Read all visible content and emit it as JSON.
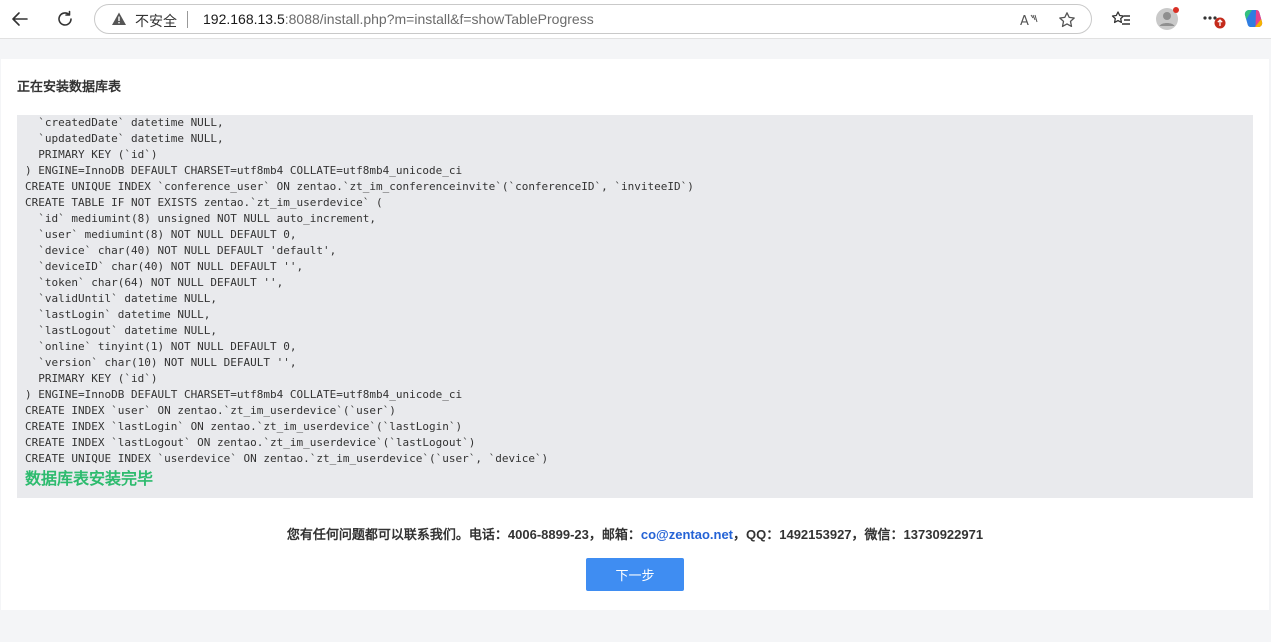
{
  "browser": {
    "insecure_label": "不安全",
    "url_host": "192.168.13.5",
    "url_rest": ":8088/install.php?m=install&f=showTableProgress",
    "icons": {
      "back": "back-arrow-icon",
      "refresh": "refresh-icon",
      "warning": "warning-icon",
      "read_aloud": "read-aloud-icon",
      "favorite": "star-icon",
      "favorites_bar": "favorites-icon",
      "profile": "profile-icon",
      "more": "more-icon",
      "copilot": "copilot-icon"
    },
    "notification_badge": "1"
  },
  "page": {
    "title": "正在安装数据库表",
    "log_lines": [
      "  `createdDate` datetime NULL,",
      "  `updatedDate` datetime NULL,",
      "  PRIMARY KEY (`id`)",
      ") ENGINE=InnoDB DEFAULT CHARSET=utf8mb4 COLLATE=utf8mb4_unicode_ci",
      "CREATE UNIQUE INDEX `conference_user` ON zentao.`zt_im_conferenceinvite`(`conferenceID`, `inviteeID`)",
      "CREATE TABLE IF NOT EXISTS zentao.`zt_im_userdevice` (",
      "  `id` mediumint(8) unsigned NOT NULL auto_increment,",
      "  `user` mediumint(8) NOT NULL DEFAULT 0,",
      "  `device` char(40) NOT NULL DEFAULT 'default',",
      "  `deviceID` char(40) NOT NULL DEFAULT '',",
      "  `token` char(64) NOT NULL DEFAULT '',",
      "  `validUntil` datetime NULL,",
      "  `lastLogin` datetime NULL,",
      "  `lastLogout` datetime NULL,",
      "  `online` tinyint(1) NOT NULL DEFAULT 0,",
      "  `version` char(10) NOT NULL DEFAULT '',",
      "  PRIMARY KEY (`id`)",
      ") ENGINE=InnoDB DEFAULT CHARSET=utf8mb4 COLLATE=utf8mb4_unicode_ci",
      "CREATE INDEX `user` ON zentao.`zt_im_userdevice`(`user`)",
      "CREATE INDEX `lastLogin` ON zentao.`zt_im_userdevice`(`lastLogin`)",
      "CREATE INDEX `lastLogout` ON zentao.`zt_im_userdevice`(`lastLogout`)",
      "CREATE UNIQUE INDEX `userdevice` ON zentao.`zt_im_userdevice`(`user`, `device`)"
    ],
    "done_text": "数据库表安装完毕",
    "contact": {
      "prefix": "您有任何问题都可以联系我们。电话：4006-8899-23，邮箱：",
      "email": "co@zentao.net",
      "suffix": "，QQ：1492153927，微信：13730922971"
    },
    "next_button_label": "下一步"
  },
  "colors": {
    "success_text": "#2dbb6e",
    "primary_button": "#3f8df2",
    "link": "#2463d6"
  }
}
